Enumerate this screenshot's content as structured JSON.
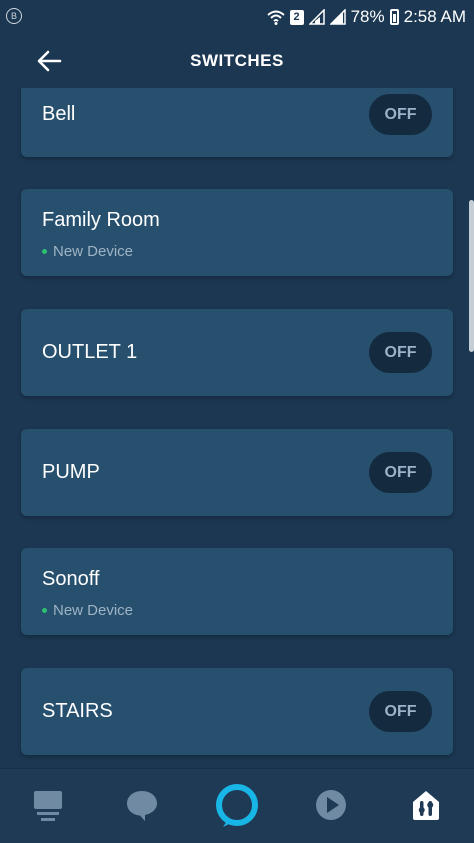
{
  "status_bar": {
    "left_glyph": "B",
    "sim_badge": "2",
    "battery": "78%",
    "time": "2:58 AM",
    "icons": [
      "wifi-icon",
      "signal-icon",
      "signal-icon",
      "battery-icon"
    ]
  },
  "header": {
    "title": "SWITCHES",
    "back_icon": "arrow-left-icon"
  },
  "devices": [
    {
      "name": "Bell",
      "toggle": "OFF"
    },
    {
      "name": "Family Room",
      "subtitle": "New Device"
    },
    {
      "name": "OUTLET 1",
      "toggle": "OFF"
    },
    {
      "name": "PUMP",
      "toggle": "OFF"
    },
    {
      "name": "Sonoff",
      "subtitle": "New Device"
    },
    {
      "name": "STAIRS",
      "toggle": "OFF"
    }
  ],
  "bottom_nav": {
    "items": [
      "home-icon",
      "chat-icon",
      "alexa-icon",
      "play-icon",
      "devices-icon"
    ],
    "active": "devices-icon"
  },
  "colors": {
    "background": "#1b3752",
    "card": "#27506f",
    "toggle_bg": "#132a3f",
    "new_device_dot": "#2fbf71",
    "alexa_ring": "#18b6e6"
  }
}
